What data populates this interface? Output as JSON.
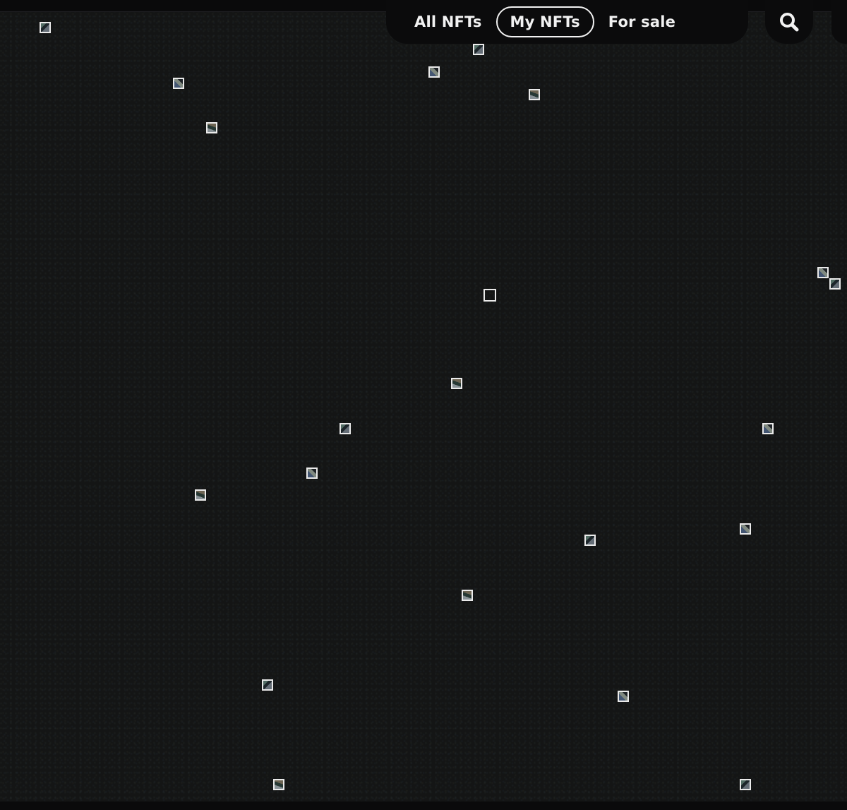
{
  "nav": {
    "tabs": [
      {
        "label": "All NFTs",
        "active": false
      },
      {
        "label": "My NFTs",
        "active": true
      },
      {
        "label": "For sale",
        "active": false
      }
    ]
  },
  "icons": {
    "search": "search-icon"
  },
  "colors": {
    "background": "#141515",
    "panel": "#0b0b0c",
    "text": "#f2f2f2"
  }
}
